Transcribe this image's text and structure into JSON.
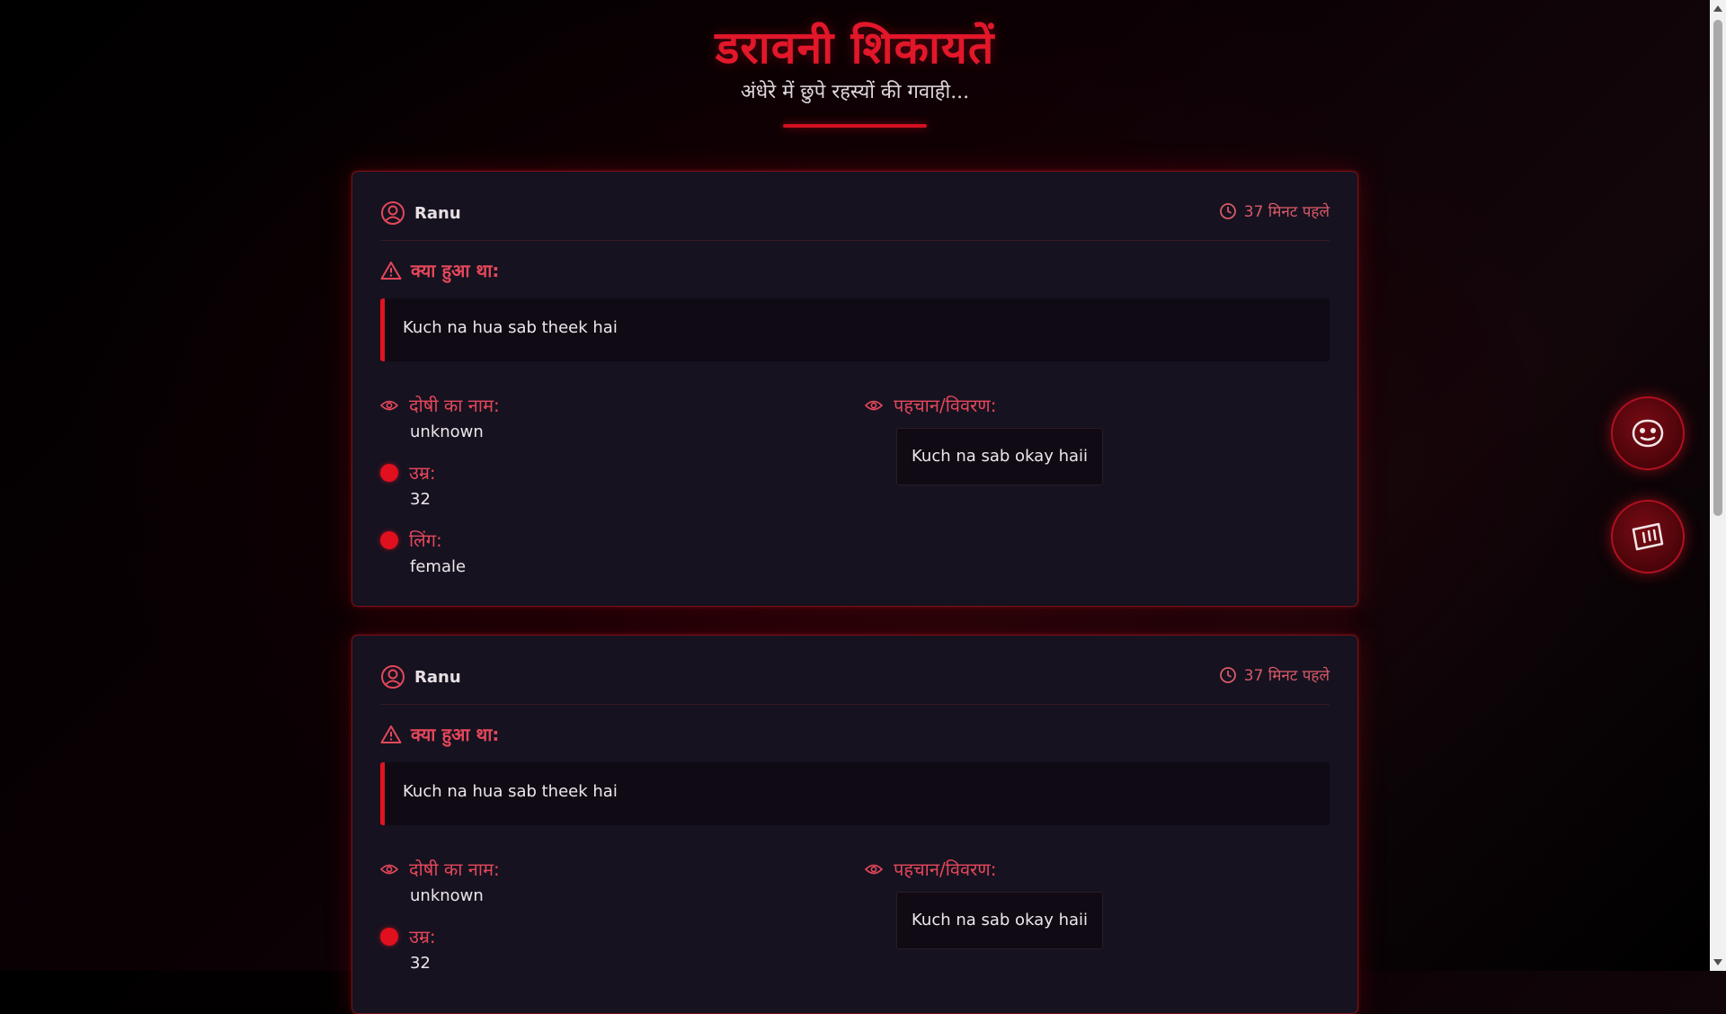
{
  "header": {
    "title": "डरावनी शिकायतें",
    "subtitle": "अंधेरे में छुपे रहस्यों की गवाही..."
  },
  "labels": {
    "what_happened": "क्या हुआ था:",
    "culprit_name": "दोषी का नाम:",
    "age": "उम्र:",
    "gender": "लिंग:",
    "identity": "पहचान/विवरण:"
  },
  "complaints": [
    {
      "user": "Ranu",
      "time": "37 मिनट पहले",
      "story": "Kuch na hua sab theek hai",
      "culprit_name": "unknown",
      "age": "32",
      "gender": "female",
      "identity": "Kuch na sab okay haii"
    },
    {
      "user": "Ranu",
      "time": "37 मिनट पहले",
      "story": "Kuch na hua sab theek hai",
      "culprit_name": "unknown",
      "age": "32",
      "identity": "Kuch na sab okay haii"
    }
  ],
  "icons": {
    "user": "user-circle-icon",
    "clock": "clock-icon",
    "warning": "warning-triangle-icon",
    "eye": "eye-icon",
    "fab_top": "ghost-mask-icon",
    "fab_bottom": "ticket-chart-icon"
  },
  "colors": {
    "accent": "#e3172a",
    "card_bg": "#161220",
    "page_bg": "#000000"
  }
}
